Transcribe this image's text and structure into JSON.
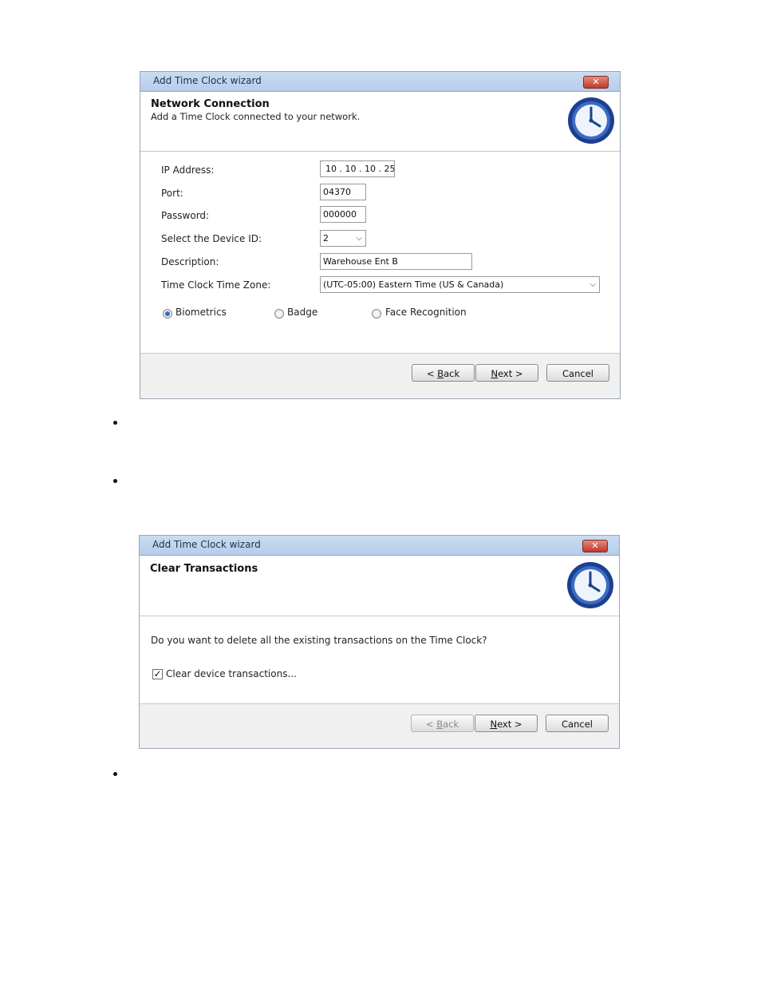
{
  "wizard1": {
    "title": "Add Time Clock wizard",
    "close_label": "✕",
    "heading": "Network Connection",
    "subheading": "Add a Time Clock connected to your network.",
    "fields": {
      "ip_label": "IP Address:",
      "ip_value": "10 . 10 . 10 . 25",
      "port_label": "Port:",
      "port_value": "04370",
      "password_label": "Password:",
      "password_value": "000000",
      "device_label": "Select the Device ID:",
      "device_value": "2",
      "description_label": "Description:",
      "description_value": "Warehouse Ent B",
      "timezone_label": "Time Clock Time Zone:",
      "timezone_value": "(UTC-05:00) Eastern Time (US & Canada)"
    },
    "radios": {
      "biometrics": "Biometrics",
      "badge": "Badge",
      "face": "Face Recognition",
      "selected": "Biometrics"
    },
    "buttons": {
      "back_prefix": "< ",
      "back_key": "B",
      "back_rest": "ack",
      "next_key": "N",
      "next_rest": "ext >",
      "cancel": "Cancel"
    }
  },
  "wizard2": {
    "title": "Add Time Clock wizard",
    "close_label": "✕",
    "heading": "Clear Transactions",
    "question": "Do you want to delete all the existing transactions on the Time Clock?",
    "checkbox_label": "Clear device transactions...",
    "checkbox_checked": true,
    "buttons": {
      "back_prefix": "< ",
      "back_key": "B",
      "back_rest": "ack",
      "next_key": "N",
      "next_rest": "ext >",
      "cancel": "Cancel"
    }
  },
  "colors": {
    "titlebar": "#c9dcf2",
    "clock_blue": "#1d3f8f",
    "footer": "#f0f0f0"
  },
  "icons": [
    "close-icon",
    "clock-icon",
    "dropdown-arrow-icon",
    "checkmark-icon",
    "radio-icon"
  ]
}
